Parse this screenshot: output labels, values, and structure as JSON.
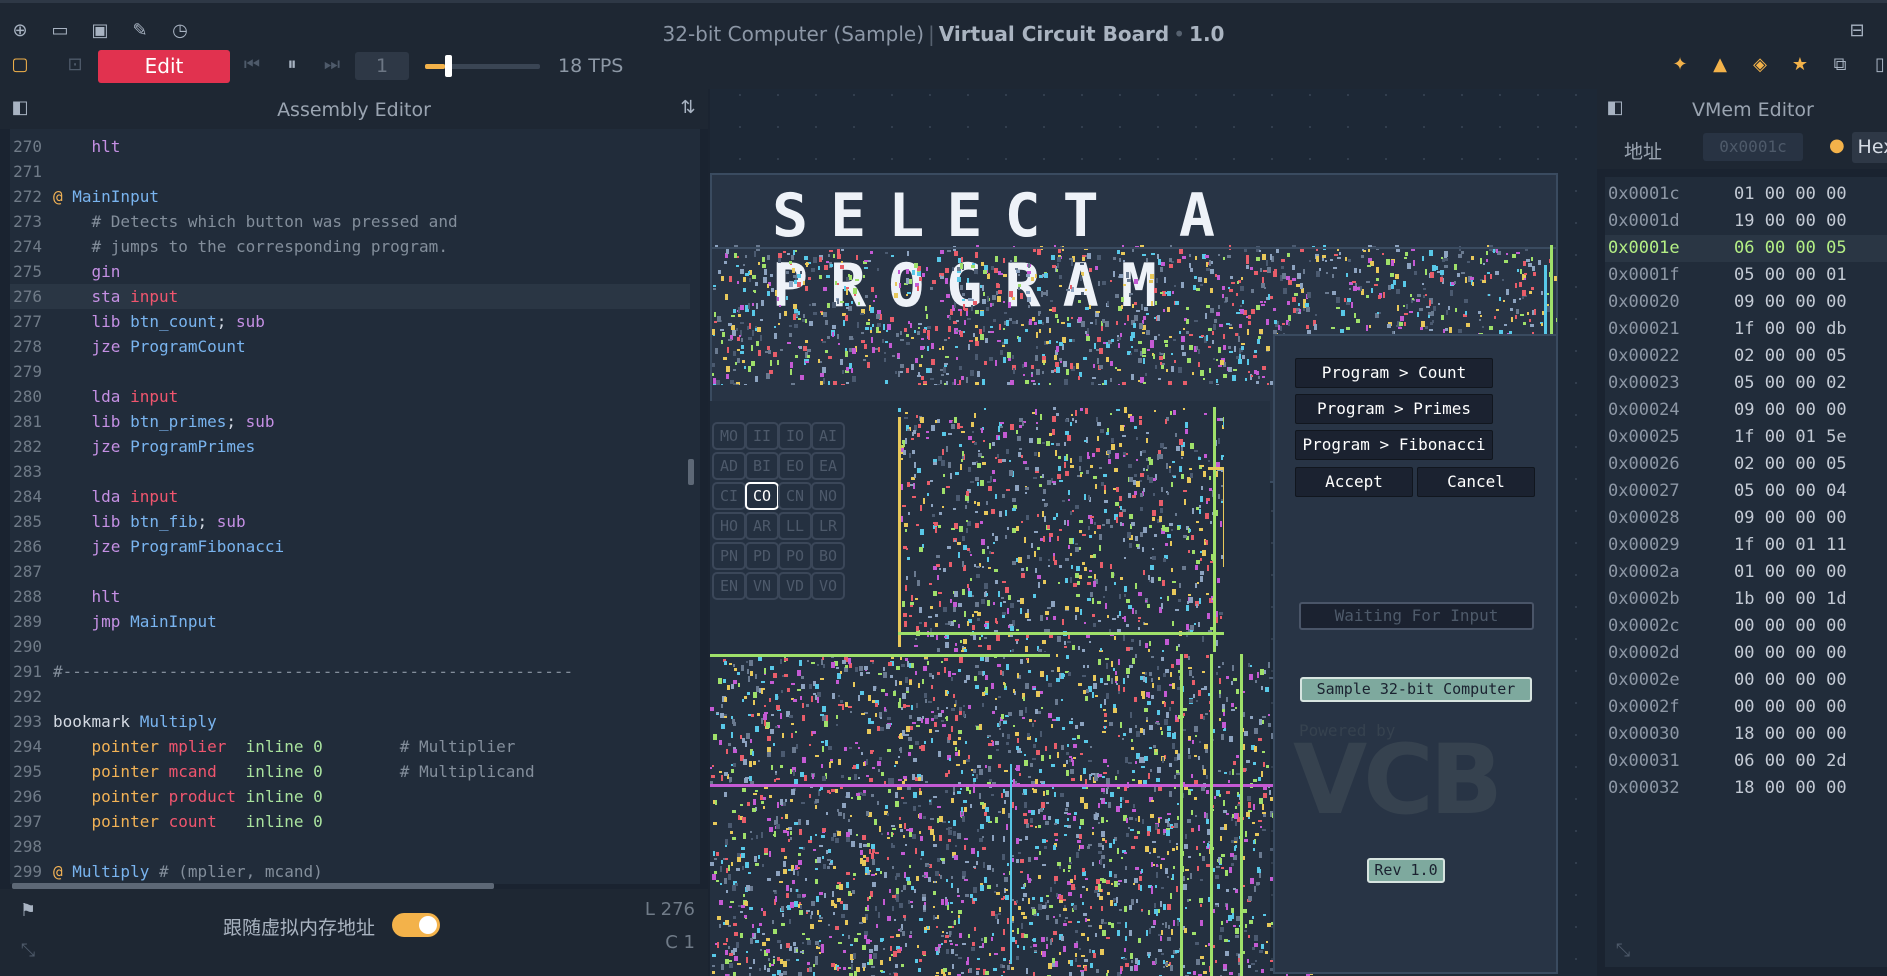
{
  "window": {
    "doc_title": "32-bit Computer (Sample)",
    "app_name": "Virtual Circuit Board",
    "version": "1.0"
  },
  "toolbar": {
    "edit_label": "Edit",
    "speed_value": "1",
    "tps_label": "18 TPS",
    "tick_speed_fraction": 0.17
  },
  "left_panel": {
    "title": "Assembly Editor",
    "follow_label": "跟随虚拟内存地址",
    "line_indicator": "L 276",
    "col_indicator": "C 1",
    "code": [
      {
        "n": "270",
        "t": [
          {
            "c": "kw",
            "v": "    hlt"
          }
        ]
      },
      {
        "n": "271",
        "t": []
      },
      {
        "n": "272",
        "t": [
          {
            "c": "at",
            "v": "@ "
          },
          {
            "c": "lbl",
            "v": "MainInput"
          }
        ]
      },
      {
        "n": "273",
        "t": [
          {
            "c": "cm",
            "v": "    # Detects which button was pressed and"
          }
        ]
      },
      {
        "n": "274",
        "t": [
          {
            "c": "cm",
            "v": "    # jumps to the corresponding program."
          }
        ]
      },
      {
        "n": "275",
        "t": [
          {
            "c": "kw",
            "v": "    gin"
          }
        ]
      },
      {
        "n": "276",
        "hl": true,
        "t": [
          {
            "c": "kw",
            "v": "    sta "
          },
          {
            "c": "red",
            "v": "input"
          }
        ]
      },
      {
        "n": "277",
        "t": [
          {
            "c": "kw",
            "v": "    lib "
          },
          {
            "c": "lbl",
            "v": "btn_count"
          },
          {
            "c": "txt",
            "v": "; "
          },
          {
            "c": "kw",
            "v": "sub"
          }
        ]
      },
      {
        "n": "278",
        "t": [
          {
            "c": "kw",
            "v": "    jze "
          },
          {
            "c": "lbl",
            "v": "ProgramCount"
          }
        ]
      },
      {
        "n": "279",
        "t": []
      },
      {
        "n": "280",
        "t": [
          {
            "c": "kw",
            "v": "    lda "
          },
          {
            "c": "red",
            "v": "input"
          }
        ]
      },
      {
        "n": "281",
        "t": [
          {
            "c": "kw",
            "v": "    lib "
          },
          {
            "c": "lbl",
            "v": "btn_primes"
          },
          {
            "c": "txt",
            "v": "; "
          },
          {
            "c": "kw",
            "v": "sub"
          }
        ]
      },
      {
        "n": "282",
        "t": [
          {
            "c": "kw",
            "v": "    jze "
          },
          {
            "c": "lbl",
            "v": "ProgramPrimes"
          }
        ]
      },
      {
        "n": "283",
        "t": []
      },
      {
        "n": "284",
        "t": [
          {
            "c": "kw",
            "v": "    lda "
          },
          {
            "c": "red",
            "v": "input"
          }
        ]
      },
      {
        "n": "285",
        "t": [
          {
            "c": "kw",
            "v": "    lib "
          },
          {
            "c": "lbl",
            "v": "btn_fib"
          },
          {
            "c": "txt",
            "v": "; "
          },
          {
            "c": "kw",
            "v": "sub"
          }
        ]
      },
      {
        "n": "286",
        "t": [
          {
            "c": "kw",
            "v": "    jze "
          },
          {
            "c": "lbl",
            "v": "ProgramFibonacci"
          }
        ]
      },
      {
        "n": "287",
        "t": []
      },
      {
        "n": "288",
        "t": [
          {
            "c": "kw",
            "v": "    hlt"
          }
        ]
      },
      {
        "n": "289",
        "t": [
          {
            "c": "kw",
            "v": "    jmp "
          },
          {
            "c": "lbl",
            "v": "MainInput"
          }
        ]
      },
      {
        "n": "290",
        "t": []
      },
      {
        "n": "291",
        "t": [
          {
            "c": "cm",
            "v": "#-----------------------------------------------------"
          }
        ]
      },
      {
        "n": "292",
        "t": []
      },
      {
        "n": "293",
        "t": [
          {
            "c": "txt",
            "v": "bookmark "
          },
          {
            "c": "lbl",
            "v": "Multiply"
          }
        ]
      },
      {
        "n": "294",
        "t": [
          {
            "c": "at",
            "v": "    pointer "
          },
          {
            "c": "red",
            "v": "mplier"
          },
          {
            "c": "txt",
            "v": "  "
          },
          {
            "c": "num",
            "v": "inline 0"
          },
          {
            "c": "cm",
            "v": "        # Multiplier"
          }
        ]
      },
      {
        "n": "295",
        "t": [
          {
            "c": "at",
            "v": "    pointer "
          },
          {
            "c": "red",
            "v": "mcand"
          },
          {
            "c": "txt",
            "v": "   "
          },
          {
            "c": "num",
            "v": "inline 0"
          },
          {
            "c": "cm",
            "v": "        # Multiplicand"
          }
        ]
      },
      {
        "n": "296",
        "t": [
          {
            "c": "at",
            "v": "    pointer "
          },
          {
            "c": "red",
            "v": "product"
          },
          {
            "c": "txt",
            "v": " "
          },
          {
            "c": "num",
            "v": "inline 0"
          }
        ]
      },
      {
        "n": "297",
        "t": [
          {
            "c": "at",
            "v": "    pointer "
          },
          {
            "c": "red",
            "v": "count"
          },
          {
            "c": "txt",
            "v": "   "
          },
          {
            "c": "num",
            "v": "inline 0"
          }
        ]
      },
      {
        "n": "298",
        "t": []
      },
      {
        "n": "299",
        "t": [
          {
            "c": "at",
            "v": "@ "
          },
          {
            "c": "lbl",
            "v": "Multiply"
          },
          {
            "c": "cm",
            "v": " # (mplier, mcand)"
          }
        ]
      }
    ]
  },
  "circuit": {
    "select_title": "SELECT A PROGRAM",
    "control_lines": [
      [
        "MO",
        "II",
        "IO",
        "AI"
      ],
      [
        "AD",
        "BI",
        "EO",
        "EA"
      ],
      [
        "CI",
        "CO",
        "CN",
        "NO"
      ],
      [
        "HO",
        "AR",
        "LL",
        "LR"
      ],
      [
        "PN",
        "PD",
        "PO",
        "BO"
      ],
      [
        "EN",
        "VN",
        "VD",
        "VO"
      ]
    ],
    "active_control": "CO",
    "program_buttons": [
      "Program > Count",
      "Program > Primes",
      "Program > Fibonacci"
    ],
    "accept_label": "Accept",
    "cancel_label": "Cancel",
    "status_text": "Waiting For Input",
    "badge_text": "Sample 32-bit Computer",
    "powered_by": "Powered by",
    "logo_text": "VCB",
    "revision_text": "Rev 1.0"
  },
  "right_panel": {
    "title": "VMem Editor",
    "address_label": "地址",
    "address_placeholder": "0x0001c",
    "format_label": "Hex",
    "rows": [
      {
        "addr": "0x0001c",
        "val": "01 00 00 00"
      },
      {
        "addr": "0x0001d",
        "val": "19 00 00 00"
      },
      {
        "addr": "0x0001e",
        "val": "06 00 00 05",
        "hl": true
      },
      {
        "addr": "0x0001f",
        "val": "05 00 00 01"
      },
      {
        "addr": "0x00020",
        "val": "09 00 00 00"
      },
      {
        "addr": "0x00021",
        "val": "1f 00 00 db"
      },
      {
        "addr": "0x00022",
        "val": "02 00 00 05"
      },
      {
        "addr": "0x00023",
        "val": "05 00 00 02"
      },
      {
        "addr": "0x00024",
        "val": "09 00 00 00"
      },
      {
        "addr": "0x00025",
        "val": "1f 00 01 5e"
      },
      {
        "addr": "0x00026",
        "val": "02 00 00 05"
      },
      {
        "addr": "0x00027",
        "val": "05 00 00 04"
      },
      {
        "addr": "0x00028",
        "val": "09 00 00 00"
      },
      {
        "addr": "0x00029",
        "val": "1f 00 01 11"
      },
      {
        "addr": "0x0002a",
        "val": "01 00 00 00"
      },
      {
        "addr": "0x0002b",
        "val": "1b 00 00 1d"
      },
      {
        "addr": "0x0002c",
        "val": "00 00 00 00"
      },
      {
        "addr": "0x0002d",
        "val": "00 00 00 00"
      },
      {
        "addr": "0x0002e",
        "val": "00 00 00 00"
      },
      {
        "addr": "0x0002f",
        "val": "00 00 00 00"
      },
      {
        "addr": "0x00030",
        "val": "18 00 00 00"
      },
      {
        "addr": "0x00031",
        "val": "06 00 00 2d"
      },
      {
        "addr": "0x00032",
        "val": "18 00 00 00"
      }
    ]
  },
  "colors": {
    "accent_red": "#e1324f",
    "accent_amber": "#f3b24a",
    "highlight_green": "#b4ef85"
  }
}
